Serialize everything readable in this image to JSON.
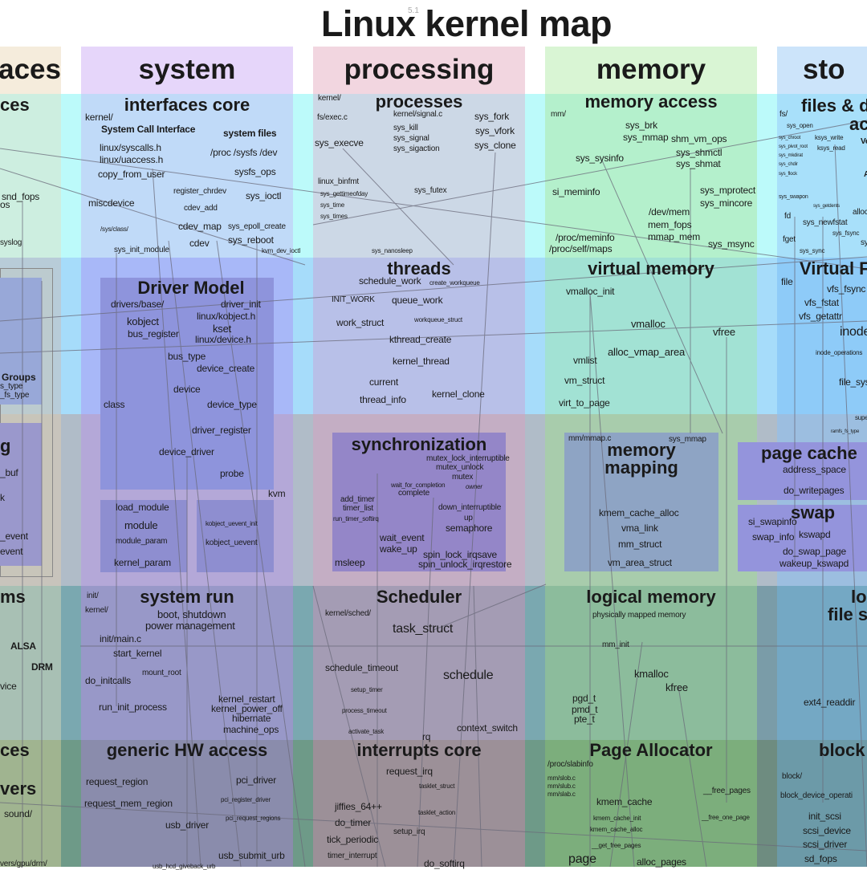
{
  "title": "Linux kernel map",
  "version": "5.1",
  "columns": [
    {
      "label": "faces",
      "color": "#f5ecdc"
    },
    {
      "label": "system",
      "color": "#e6d6fa"
    },
    {
      "label": "processing",
      "color": "#f2d6e0"
    },
    {
      "label": "memory",
      "color": "#d9f5d4"
    },
    {
      "label": "sto",
      "color": "#cce4fa"
    }
  ],
  "rows": {
    "interfaces": {
      "color": "#bff8fa"
    },
    "virtual": {
      "color": "#aadcfa"
    },
    "bridges": {
      "color": "#c4c0cc"
    },
    "logical": {
      "color": "#8fb6b4"
    },
    "hw": {
      "color": "#7da696"
    }
  },
  "sections": {
    "left_interfaces": "ces",
    "interfaces_core": "interfaces core",
    "processes": "processes",
    "memory_access": "memory access",
    "files_access_1": "files & d",
    "files_access_2": "ac",
    "groups": "Groups",
    "driver_model": "Driver Model",
    "threads": "threads",
    "virtual_memory": "virtual memory",
    "virtual_fs": "Virtual F",
    "left_g": "g",
    "synchronization": "synchronization",
    "memory_mapping_1": "memory",
    "memory_mapping_2": "mapping",
    "page_cache": "page cache",
    "swap": "swap",
    "left_ms": "ms",
    "system_run": "system run",
    "scheduler": "Scheduler",
    "logical_memory": "logical memory",
    "logical_fs_1": "lo",
    "logical_fs_2": "file s",
    "left_ces": "ces",
    "left_vers": "vers",
    "generic_hw": "generic HW access",
    "interrupts_core": "interrupts core",
    "page_allocator": "Page Allocator",
    "block": "block"
  },
  "labels": {
    "left": [
      "snd_fops",
      "os",
      "syslog",
      "s_type",
      "_fs_type",
      "_buf",
      "k",
      "_event",
      "event",
      "ALSA",
      "DRM",
      "vice",
      "sound/",
      "vers/gpu/drm/"
    ],
    "interfaces_core": [
      "kernel/",
      "System Call Interface",
      "system files",
      "linux/syscalls.h",
      "linux/uaccess.h",
      "/proc  /sysfs  /dev",
      "copy_from_user",
      "sysfs_ops",
      "register_chrdev",
      "sys_ioctl",
      "miscdevice",
      "cdev_add",
      "/sys/class/",
      "cdev_map",
      "sys_epoll_create",
      "sys_reboot",
      "cdev",
      "sys_init_module",
      "kvm_dev_ioctl"
    ],
    "processes": [
      "kernel/",
      "fs/exec.c",
      "kernel/signal.c",
      "sys_fork",
      "sys_kill",
      "sys_vfork",
      "sys_signal",
      "sys_execve",
      "sys_sigaction",
      "sys_clone",
      "linux_binfmt",
      "sys_futex",
      "sys_gettimeofday",
      "sys_time",
      "sys_times",
      "sys_nanosleep"
    ],
    "memory_access": [
      "mm/",
      "sys_brk",
      "sys_mmap",
      "shm_vm_ops",
      "sys_sysinfo",
      "sys_shmctl",
      "sys_shmat",
      "si_meminfo",
      "sys_mprotect",
      "sys_mincore",
      "/dev/mem",
      "mem_fops",
      "/proc/meminfo",
      "mmap_mem",
      "/proc/self/maps",
      "sys_msync"
    ],
    "files_access": [
      "fs/",
      "sys_open",
      "sys_chroot",
      "ksys_write",
      "sys_pivot_root",
      "ksys_read",
      "sys_mkdirat",
      "sys_chdir",
      "sys_flock",
      "sys_swapon",
      "sys_getdents",
      "alloc",
      "fd",
      "sys_newfstat",
      "sys_fsync",
      "fget",
      "sys_sync",
      "Ve",
      "A",
      "sy"
    ],
    "driver_model": [
      "drivers/base/",
      "driver_init",
      "linux/kobject.h",
      "kobject",
      "kset",
      "bus_register",
      "linux/device.h",
      "bus_type",
      "device_create",
      "device",
      "class",
      "device_type",
      "driver_register",
      "device_driver",
      "probe",
      "kvm",
      "load_module",
      "module",
      "module_param",
      "kernel_param",
      "kobject_uevent_init",
      "kobject_uevent"
    ],
    "threads": [
      "schedule_work",
      "create_workqueue",
      "INIT_WORK",
      "queue_work",
      "work_struct",
      "workqueue_struct",
      "kthread_create",
      "kernel_thread",
      "current",
      "thread_info",
      "kernel_clone"
    ],
    "virtual_memory": [
      "vmalloc_init",
      "vmalloc",
      "vfree",
      "alloc_vmap_area",
      "vmlist",
      "vm_struct",
      "virt_to_page"
    ],
    "virtual_fs": [
      "file",
      "vfs_fsync",
      "vfs_fstat",
      "vfs_getattr",
      "inode",
      "inode_operations",
      "file_sys",
      "supe",
      "ramfs_fs_type"
    ],
    "synchronization": [
      "mutex_lock_interruptible",
      "mutex_unlock",
      "mutex",
      "wait_for_completion",
      "owner",
      "complete",
      "add_timer",
      "timer_list",
      "down_interruptible",
      "run_timer_softirq",
      "up",
      "semaphore",
      "wait_event",
      "wake_up",
      "spin_lock_irqsave",
      "msleep",
      "spin_unlock_irqrestore"
    ],
    "memory_mapping": [
      "mm/mmap.c",
      "sys_mmap",
      "kmem_cache_alloc",
      "vma_link",
      "mm_struct",
      "vm_area_struct"
    ],
    "page_cache": [
      "address_space",
      "do_writepages"
    ],
    "swap": [
      "si_swapinfo",
      "swap_info",
      "kswapd",
      "do_swap_page",
      "wakeup_kswapd"
    ],
    "system_run": [
      "init/",
      "kernel/",
      "boot, shutdown",
      "power management",
      "init/main.c",
      "start_kernel",
      "mount_root",
      "do_initcalls",
      "run_init_process",
      "kernel_restart",
      "kernel_power_off",
      "hibernate",
      "machine_ops"
    ],
    "scheduler": [
      "kernel/sched/",
      "task_struct",
      "schedule_timeout",
      "schedule",
      "setup_timer",
      "process_timeout",
      "activate_task",
      "rq",
      "context_switch"
    ],
    "logical_memory": [
      "physically mapped memory",
      "mm_init",
      "kmalloc",
      "kfree",
      "pgd_t",
      "pmd_t",
      "pte_t"
    ],
    "logical_fs": [
      "ext4_readdir"
    ],
    "generic_hw": [
      "request_region",
      "pci_driver",
      "request_mem_region",
      "pci_register_driver",
      "pci_request_regions",
      "usb_driver",
      "usb_submit_urb",
      "usb_hcd_giveback_urb"
    ],
    "interrupts_core": [
      "request_irq",
      "tasklet_struct",
      "jiffies_64++",
      "tasklet_action",
      "do_timer",
      "setup_irq",
      "tick_periodic",
      "timer_interrupt",
      "do_softirq"
    ],
    "page_allocator": [
      "/proc/slabinfo",
      "mm/slob.c",
      "mm/slub.c",
      "mm/slab.c",
      "__free_pages",
      "kmem_cache",
      "__free_one_page",
      "kmem_cache_init",
      "kmem_cache_alloc",
      "__get_free_pages",
      "page",
      "alloc_pages"
    ],
    "block": [
      "block/",
      "block_device_operati",
      "init_scsi",
      "scsi_device",
      "scsi_driver",
      "sd_fops"
    ]
  }
}
